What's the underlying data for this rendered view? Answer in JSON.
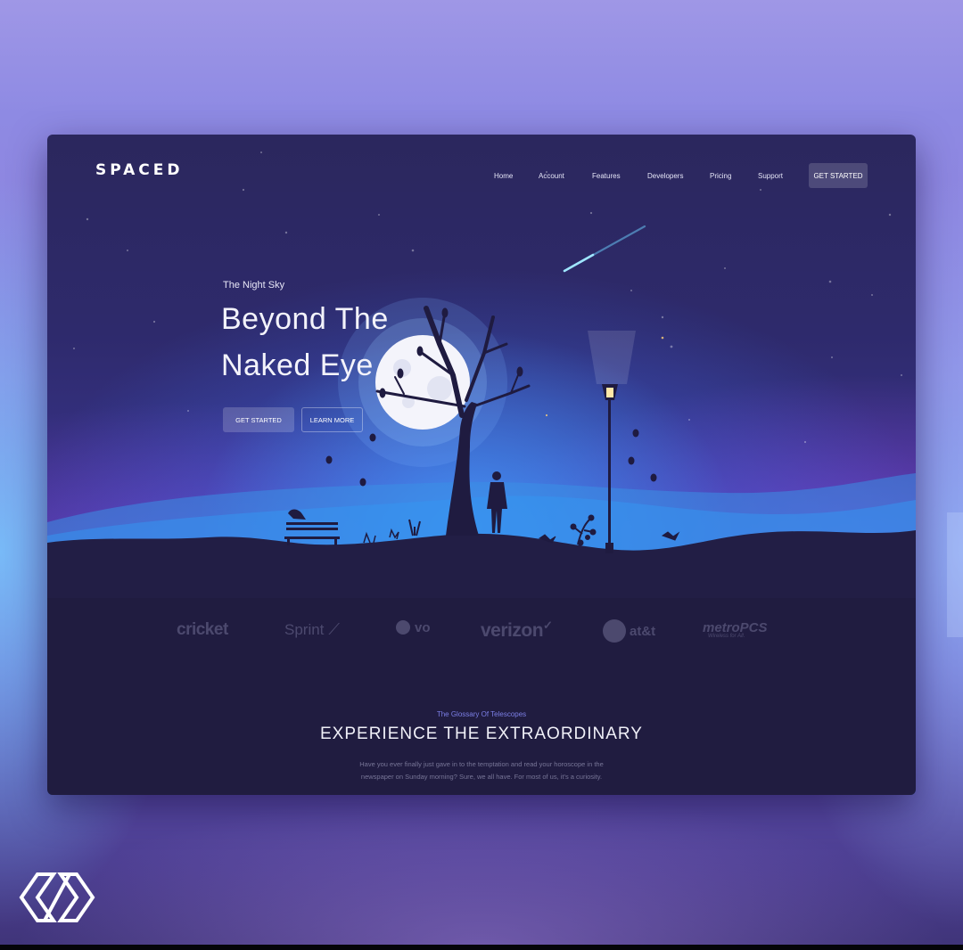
{
  "brand": {
    "logo_text": "SPACED"
  },
  "nav": {
    "items": [
      "Home",
      "Account",
      "Features",
      "Developers",
      "Pricing",
      "Support"
    ],
    "cta_label": "GET STARTED"
  },
  "hero": {
    "eyebrow": "The Night Sky",
    "title_line1": "Beyond The",
    "title_line2": "Naked Eye",
    "primary_button": "GET STARTED",
    "secondary_button": "LEARN MORE"
  },
  "partners": {
    "logos": [
      {
        "name": "cricket",
        "icon": "cricket-logo-icon"
      },
      {
        "name": "Sprint",
        "icon": "sprint-logo-icon"
      },
      {
        "name": "vo",
        "icon": "vo-logo-icon"
      },
      {
        "name": "verizon",
        "icon": "verizon-logo-icon"
      },
      {
        "name": "at&t",
        "icon": "att-globe-icon"
      },
      {
        "name": "metroPCS",
        "subtitle": "Wireless for All.",
        "icon": "metropcs-logo-icon"
      }
    ]
  },
  "section": {
    "eyebrow": "The Glossary Of Telescopes",
    "title": "EXPERIENCE THE EXTRAORDINARY",
    "body_line1": "Have you ever finally just gave in to the temptation and read your horoscope in the",
    "body_line2": "newspaper on Sunday morning? Sure, we all have. For most of us, it's a curiosity."
  },
  "colors": {
    "accent": "#7c7fe6",
    "sky_top": "#2b275d",
    "sky_glow": "#3aa0ff",
    "ground": "#211c42",
    "moon": "#f4f4fb"
  },
  "icons": [
    "shooting-star-icon",
    "moon-icon",
    "tree-icon",
    "street-lamp-icon",
    "bench-icon",
    "person-icon",
    "bird-icon",
    "corner-brand-icon"
  ]
}
